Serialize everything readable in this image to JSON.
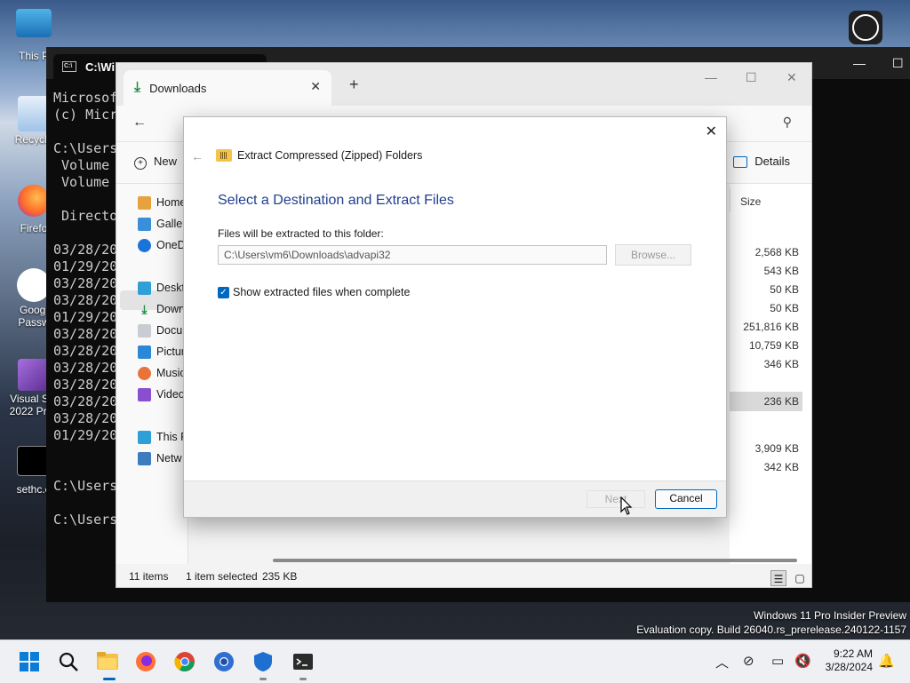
{
  "desktop": {
    "icons": [
      {
        "label": "This P"
      },
      {
        "label": "Recycle"
      },
      {
        "label": "Firefo"
      },
      {
        "label": "Googl\nPassw"
      },
      {
        "label": "Visual Stu\n2022 Prev"
      },
      {
        "label": "sethc.e"
      }
    ]
  },
  "cmd": {
    "title": "C:\\Win",
    "lines": [
      "Microsof",
      "(c) Micr",
      "",
      "C:\\Users",
      " Volume ",
      " Volume ",
      "",
      " Directo",
      "",
      "03/28/20",
      "01/29/20",
      "03/28/20",
      "03/28/20",
      "01/29/20",
      "03/28/20",
      "03/28/20",
      "03/28/20",
      "03/28/20",
      "03/28/20",
      "03/28/20",
      "01/29/20",
      "",
      "",
      "C:\\Users",
      "",
      "C:\\Users"
    ]
  },
  "explorer": {
    "tab_title": "Downloads",
    "tab_close": "✕",
    "new_tab": "+",
    "new_label": "New",
    "details_label": "Details",
    "size_header": "Size",
    "nav_items": [
      {
        "label": "Home"
      },
      {
        "label": "Galler"
      },
      {
        "label": "OneD"
      },
      {
        "label": "Deskt"
      },
      {
        "label": "Down"
      },
      {
        "label": "Docu"
      },
      {
        "label": "Pictur"
      },
      {
        "label": "Music"
      },
      {
        "label": "Video"
      },
      {
        "label": "This P"
      },
      {
        "label": "Netw"
      }
    ],
    "sizes": [
      "2,568 KB",
      "543 KB",
      "50 KB",
      "50 KB",
      "251,816 KB",
      "10,759 KB",
      "346 KB",
      "236 KB",
      "3,909 KB",
      "342 KB"
    ],
    "status_items": "11 items",
    "status_selected": "1 item selected",
    "status_size": "235 KB"
  },
  "dialog": {
    "window_title": "Extract Compressed (Zipped) Folders",
    "heading": "Select a Destination and Extract Files",
    "folder_label": "Files will be extracted to this folder:",
    "path_value": "C:\\Users\\vm6\\Downloads\\advapi32",
    "browse_label": "Browse...",
    "checkbox_label": "Show extracted files when complete",
    "next_label": "Next",
    "cancel_label": "Cancel"
  },
  "watermark": {
    "line1": "Windows 11 Pro Insider Preview",
    "line2": "Evaluation copy. Build 26040.rs_prerelease.240122-1157"
  },
  "taskbar": {
    "time": "9:22 AM",
    "date": "3/28/2024"
  }
}
